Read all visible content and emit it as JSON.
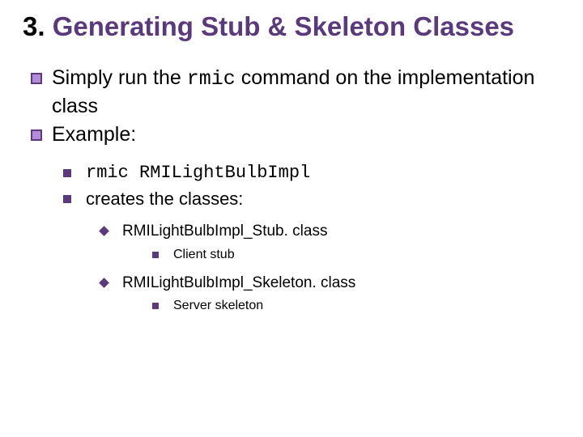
{
  "title_num": "3.",
  "title_text": "Generating Stub & Skeleton Classes",
  "l1": {
    "a1": "Simply run the ",
    "a_code": "rmic",
    "a2": " command on the implementation class",
    "b": "Example:"
  },
  "l2": {
    "a": "rmic RMILightBulbImpl",
    "b": "creates the classes:"
  },
  "l3": {
    "a": "RMILightBulbImpl_Stub. class",
    "b": "RMILightBulbImpl_Skeleton. class"
  },
  "l4": {
    "a": "Client stub",
    "b": "Server skeleton"
  }
}
